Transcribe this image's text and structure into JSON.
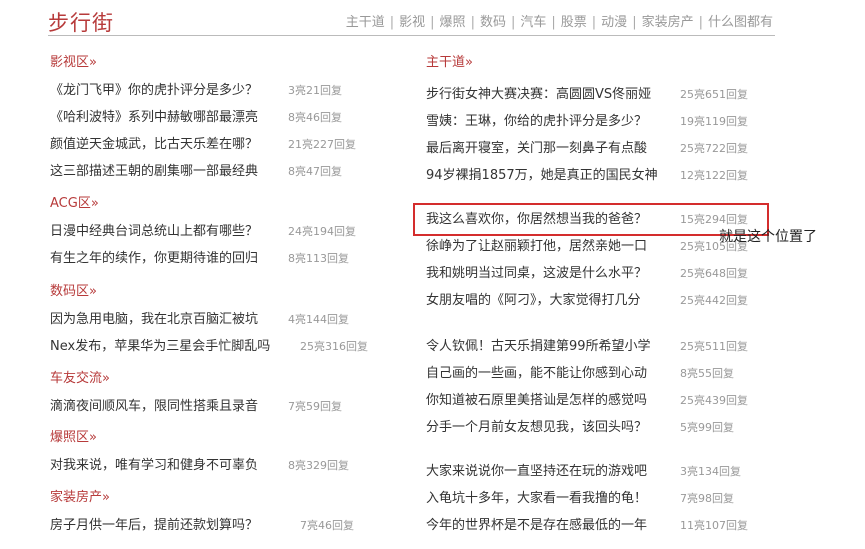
{
  "header": {
    "logo": "步行街",
    "nav": [
      "主干道",
      "影视",
      "爆照",
      "数码",
      "汽车",
      "股票",
      "动漫",
      "家装房产",
      "什么图都有"
    ]
  },
  "left": {
    "sections": [
      {
        "title": "影视区»",
        "items": [
          {
            "title": "《龙门飞甲》你的虎扑评分是多少？",
            "count": "3亮21回复"
          },
          {
            "title": "《哈利波特》系列中赫敏哪部最漂亮",
            "count": "8亮46回复"
          },
          {
            "title": "颜值逆天金城武，比古天乐差在哪？",
            "count": "21亮227回复"
          },
          {
            "title": "这三部描述王朝的剧集哪一部最经典",
            "count": "8亮47回复"
          }
        ]
      },
      {
        "title": "ACG区»",
        "items": [
          {
            "title": "日漫中经典台词总统山上都有哪些？",
            "count": "24亮194回复"
          },
          {
            "title": "有生之年的续作，你更期待谁的回归",
            "count": "8亮113回复"
          }
        ]
      },
      {
        "title": "数码区»",
        "items": [
          {
            "title": "因为急用电脑，我在北京百脑汇被坑",
            "count": "4亮144回复"
          },
          {
            "title": "Nex发布，苹果华为三星会手忙脚乱吗",
            "count": "25亮316回复"
          }
        ]
      },
      {
        "title": "车友交流»",
        "items": [
          {
            "title": "滴滴夜间顺风车，限同性搭乘且录音",
            "count": "7亮59回复"
          }
        ]
      },
      {
        "title": "爆照区»",
        "items": [
          {
            "title": "对我来说，唯有学习和健身不可辜负",
            "count": "8亮329回复"
          }
        ]
      },
      {
        "title": "家装房产»",
        "items": [
          {
            "title": "房子月供一年后，提前还款划算吗？",
            "count": "7亮46回复"
          }
        ]
      }
    ]
  },
  "right": {
    "title": "主干道»",
    "groups": [
      [
        {
          "title": "步行街女神大赛决赛：高圆圆VS佟丽娅",
          "count": "25亮651回复"
        },
        {
          "title": "雪姨：王琳，你给的虎扑评分是多少？",
          "count": "19亮119回复"
        },
        {
          "title": "最后离开寝室，关门那一刻鼻子有点酸",
          "count": "25亮722回复"
        },
        {
          "title": "94岁裸捐1857万，她是真正的国民女神",
          "count": "12亮122回复"
        }
      ],
      [
        {
          "title": "我这么喜欢你，你居然想当我的爸爸？",
          "count": "15亮294回复"
        },
        {
          "title": "徐峥为了让赵丽颖打他，居然亲她一口",
          "count": "25亮105回复"
        },
        {
          "title": "我和姚明当过同桌，这波是什么水平？",
          "count": "25亮648回复"
        },
        {
          "title": "女朋友唱的《阿刁》，大家觉得打几分",
          "count": "25亮442回复"
        }
      ],
      [
        {
          "title": "令人钦佩！古天乐捐建第99所希望小学",
          "count": "25亮511回复"
        },
        {
          "title": "自己画的一些画，能不能让你感到心动",
          "count": "8亮55回复"
        },
        {
          "title": "你知道被石原里美搭讪是怎样的感觉吗",
          "count": "25亮439回复"
        },
        {
          "title": "分手一个月前女友想见我，该回头吗？",
          "count": "5亮99回复"
        }
      ],
      [
        {
          "title": "大家来说说你一直坚持还在玩的游戏吧",
          "count": "3亮134回复"
        },
        {
          "title": "入龟坑十多年，大家看一看我撸的龟！",
          "count": "7亮98回复"
        },
        {
          "title": "今年的世界杯是不是存在感最低的一年",
          "count": "11亮107回复"
        }
      ]
    ]
  },
  "annotation": "就是这个位置了"
}
